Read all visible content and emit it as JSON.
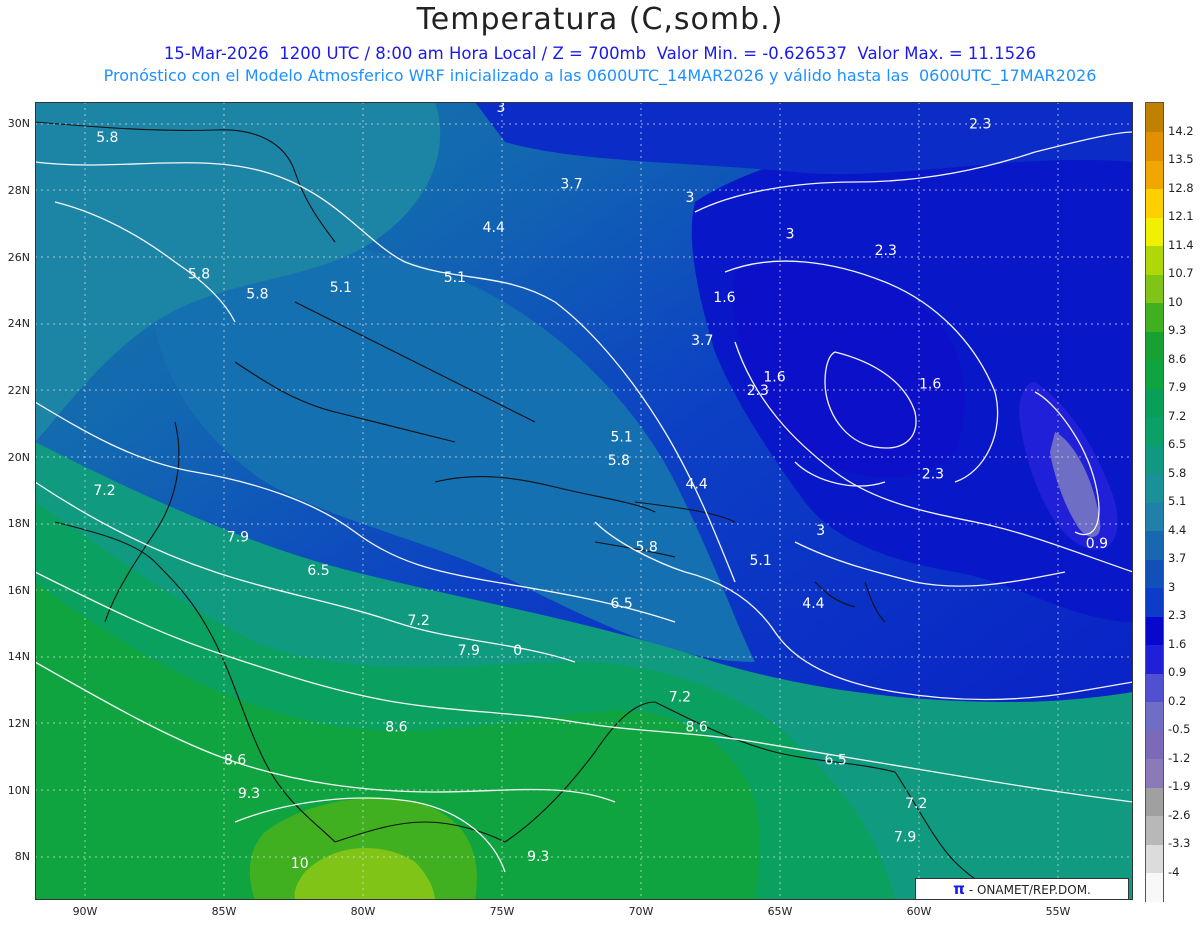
{
  "header": {
    "title": "Temperatura (C,somb.)",
    "line1": "15-Mar-2026  1200 UTC / 8:00 am Hora Local / Z = 700mb  Valor Min. = -0.626537  Valor Max. = 11.1526",
    "line2": "Pronóstico con el Modelo Atmosferico WRF inicializado a las 0600UTC_14MAR2026 y válido hasta las  0600UTC_17MAR2026"
  },
  "axes": {
    "lat_labels": [
      "30N",
      "28N",
      "26N",
      "24N",
      "22N",
      "20N",
      "18N",
      "16N",
      "14N",
      "12N",
      "10N",
      "8N"
    ],
    "lon_labels": [
      "90W",
      "85W",
      "80W",
      "75W",
      "70W",
      "65W",
      "60W",
      "55W"
    ]
  },
  "contour_labels": [
    {
      "text": "5.8",
      "lon": -89.6,
      "lat": 29.6
    },
    {
      "text": "3",
      "lon": -75.2,
      "lat": 30.5
    },
    {
      "text": "2.3",
      "lon": -58.2,
      "lat": 30.0
    },
    {
      "text": "3.7",
      "lon": -72.9,
      "lat": 28.2
    },
    {
      "text": "3",
      "lon": -68.4,
      "lat": 27.8
    },
    {
      "text": "4.4",
      "lon": -75.7,
      "lat": 26.9
    },
    {
      "text": "3",
      "lon": -64.8,
      "lat": 26.7
    },
    {
      "text": "2.3",
      "lon": -61.6,
      "lat": 26.2
    },
    {
      "text": "5.8",
      "lon": -86.3,
      "lat": 25.5
    },
    {
      "text": "5.8",
      "lon": -84.2,
      "lat": 24.9
    },
    {
      "text": "5.1",
      "lon": -81.2,
      "lat": 25.1
    },
    {
      "text": "5.1",
      "lon": -77.1,
      "lat": 25.4
    },
    {
      "text": "1.6",
      "lon": -67.4,
      "lat": 24.8
    },
    {
      "text": "3.7",
      "lon": -68.2,
      "lat": 23.5
    },
    {
      "text": "1.6",
      "lon": -65.6,
      "lat": 22.4
    },
    {
      "text": "2.3",
      "lon": -66.2,
      "lat": 22.0
    },
    {
      "text": "1.6",
      "lon": -60.0,
      "lat": 22.2
    },
    {
      "text": "5.1",
      "lon": -71.1,
      "lat": 20.6
    },
    {
      "text": "5.8",
      "lon": -71.2,
      "lat": 19.9
    },
    {
      "text": "4.4",
      "lon": -68.4,
      "lat": 19.2
    },
    {
      "text": "2.3",
      "lon": -59.9,
      "lat": 19.5
    },
    {
      "text": "7.2",
      "lon": -89.7,
      "lat": 19.0
    },
    {
      "text": "3",
      "lon": -63.7,
      "lat": 17.8
    },
    {
      "text": "7.9",
      "lon": -84.9,
      "lat": 17.6
    },
    {
      "text": "5.8",
      "lon": -70.2,
      "lat": 17.3
    },
    {
      "text": "0.9",
      "lon": -54.0,
      "lat": 17.4
    },
    {
      "text": "5.1",
      "lon": -66.1,
      "lat": 16.9
    },
    {
      "text": "6.5",
      "lon": -82.0,
      "lat": 16.6
    },
    {
      "text": "6.5",
      "lon": -71.1,
      "lat": 15.6
    },
    {
      "text": "4.4",
      "lon": -64.2,
      "lat": 15.6
    },
    {
      "text": "7.2",
      "lon": -78.4,
      "lat": 15.1
    },
    {
      "text": "7.9",
      "lon": -76.6,
      "lat": 14.2
    },
    {
      "text": "0",
      "lon": -74.6,
      "lat": 14.2
    },
    {
      "text": "7.2",
      "lon": -69.0,
      "lat": 12.8
    },
    {
      "text": "8.6",
      "lon": -79.2,
      "lat": 11.9
    },
    {
      "text": "8.6",
      "lon": -68.4,
      "lat": 11.9
    },
    {
      "text": "8.6",
      "lon": -85.0,
      "lat": 10.9
    },
    {
      "text": "6.5",
      "lon": -63.4,
      "lat": 10.9
    },
    {
      "text": "9.3",
      "lon": -84.5,
      "lat": 9.9
    },
    {
      "text": "7.2",
      "lon": -60.5,
      "lat": 9.6
    },
    {
      "text": "7.9",
      "lon": -60.9,
      "lat": 8.6
    },
    {
      "text": "9.3",
      "lon": -74.1,
      "lat": 8.0
    },
    {
      "text": "10",
      "lon": -82.6,
      "lat": 7.8
    }
  ],
  "colorbar": {
    "colors": [
      "#f8f8f8",
      "#dcdcdc",
      "#b8b8b8",
      "#a0a0a0",
      "#8c7ab8",
      "#7a6ab8",
      "#6e6ec4",
      "#5050d0",
      "#2020d8",
      "#0808cc",
      "#0c3cc8",
      "#1050b8",
      "#1868b0",
      "#2080a8",
      "#1a9098",
      "#109880",
      "#0aa068",
      "#08a058",
      "#10a440",
      "#18a030",
      "#40b020",
      "#80c418",
      "#b0d808",
      "#f0f000",
      "#ffd000",
      "#f0a800",
      "#e09000",
      "#c08000"
    ],
    "labels": [
      "-4",
      "-3.3",
      "-2.6",
      "-1.9",
      "-1.2",
      "-0.5",
      "0.2",
      "0.9",
      "1.6",
      "2.3",
      "3",
      "3.7",
      "4.4",
      "5.1",
      "5.8",
      "6.5",
      "7.2",
      "7.9",
      "8.6",
      "9.3",
      "10",
      "10.7",
      "11.4",
      "12.1",
      "12.8",
      "13.5",
      "14.2"
    ]
  },
  "credit": {
    "symbol": "π",
    "text": "- ONAMET/REP.DOM."
  }
}
